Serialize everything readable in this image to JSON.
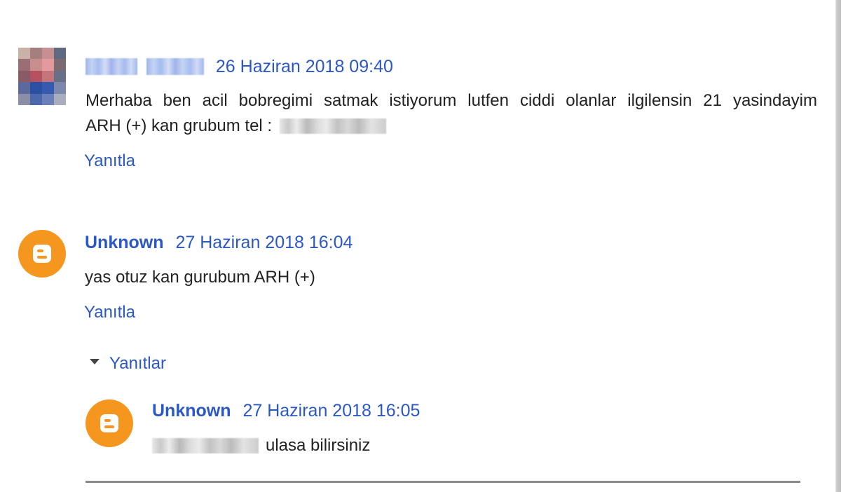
{
  "comments": [
    {
      "date": "26 Haziran 2018 09:40",
      "text_line1": "Merhaba ben acil bobregimi satmak istiyorum lutfen ciddi olanlar ilgilensin 21 yasindayim",
      "text_line2_prefix": "ARH (+) kan grubum tel :",
      "reply_label": "Yanıtla"
    },
    {
      "author": "Unknown",
      "date": "27 Haziran 2018 16:04",
      "text": "yas otuz kan gurubum ARH (+)",
      "reply_label": "Yanıtla",
      "replies_label": "Yanıtlar",
      "replies": [
        {
          "author": "Unknown",
          "date": "27 Haziran 2018 16:05",
          "text_suffix": "ulasa bilirsiniz"
        }
      ]
    }
  ],
  "colors": {
    "link": "#2b58c6",
    "text": "#222222",
    "blogger_orange": "#f5961e",
    "divider": "#8a8a8a"
  },
  "icons": {
    "avatar_default": "blogger-logo-icon",
    "replies_toggle": "triangle-down-icon"
  }
}
